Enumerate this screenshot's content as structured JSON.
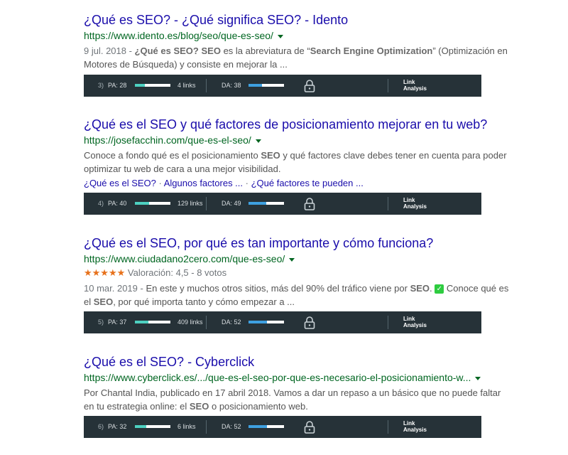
{
  "colors": {
    "title": "#1a0dab",
    "url": "#006621",
    "pa_fill": "#4dd0c0",
    "da_fill": "#3ea0e0",
    "mozbar_bg": "#263238"
  },
  "results": [
    {
      "title": "¿Qué es SEO? - ¿Qué significa SEO? - Idento",
      "url": "https://www.idento.es/blog/seo/que-es-seo/",
      "snippet_html": "<span class=\"date\">9 jul. 2018 - </span><b>¿Qué es SEO?</b> <b>SEO</b> es la abreviatura de “<b>Search Engine Optimization</b>” (Optimización en Motores de Búsqueda) y consiste en mejorar la ...",
      "moz": {
        "rank": "3)",
        "pa_label": "PA: 28",
        "pa": 28,
        "links": "4 links",
        "da_label": "DA: 38",
        "da": 38,
        "link_analysis": [
          "Link",
          "Analysis"
        ]
      }
    },
    {
      "title": "¿Qué es el SEO y qué factores de posicionamiento mejorar en tu web?",
      "url": "https://josefacchin.com/que-es-el-seo/",
      "snippet_html": "Conoce a fondo qué es el posicionamiento <b>SEO</b> y qué factores clave debes tener en cuenta para poder optimizar tu web de cara a una mejor visibilidad.",
      "sitelinks": [
        "¿Qué es el SEO?",
        "Algunos factores ...",
        "¿Qué factores te pueden ..."
      ],
      "moz": {
        "rank": "4)",
        "pa_label": "PA: 40",
        "pa": 40,
        "links": "129 links",
        "da_label": "DA: 49",
        "da": 49,
        "link_analysis": [
          "Link",
          "Analysis"
        ]
      }
    },
    {
      "title": "¿Qué es el SEO, por qué es tan importante y cómo funciona?",
      "url": "https://www.ciudadano2cero.com/que-es-seo/",
      "rating": {
        "stars": "★★★★★",
        "text": "Valoración: 4,5 - 8 votos"
      },
      "snippet_html": "<span class=\"date\">10 mar. 2019 - </span>En este y muchos otros sitios, más del 90% del tráfico viene por <b>SEO</b>. <span class=\"check\">✓</span> Conoce qué es el <b>SEO</b>, por qué importa tanto y cómo empezar a ...",
      "moz": {
        "rank": "5)",
        "pa_label": "PA: 37",
        "pa": 37,
        "links": "409 links",
        "da_label": "DA: 52",
        "da": 52,
        "link_analysis": [
          "Link",
          "Analysis"
        ]
      }
    },
    {
      "title": "¿Qué es el SEO? - Cyberclick",
      "url": "https://www.cyberclick.es/.../que-es-el-seo-por-que-es-necesario-el-posicionamiento-w...",
      "snippet_html": "Por Chantal India, publicado en 17 abril 2018. Vamos a dar un repaso a un básico que no puede faltar en tu estrategia online: el <b>SEO</b> o posicionamiento web.",
      "moz": {
        "rank": "6)",
        "pa_label": "PA: 32",
        "pa": 32,
        "links": "6 links",
        "da_label": "DA: 52",
        "da": 52,
        "link_analysis": [
          "Link",
          "Analysis"
        ]
      }
    }
  ]
}
